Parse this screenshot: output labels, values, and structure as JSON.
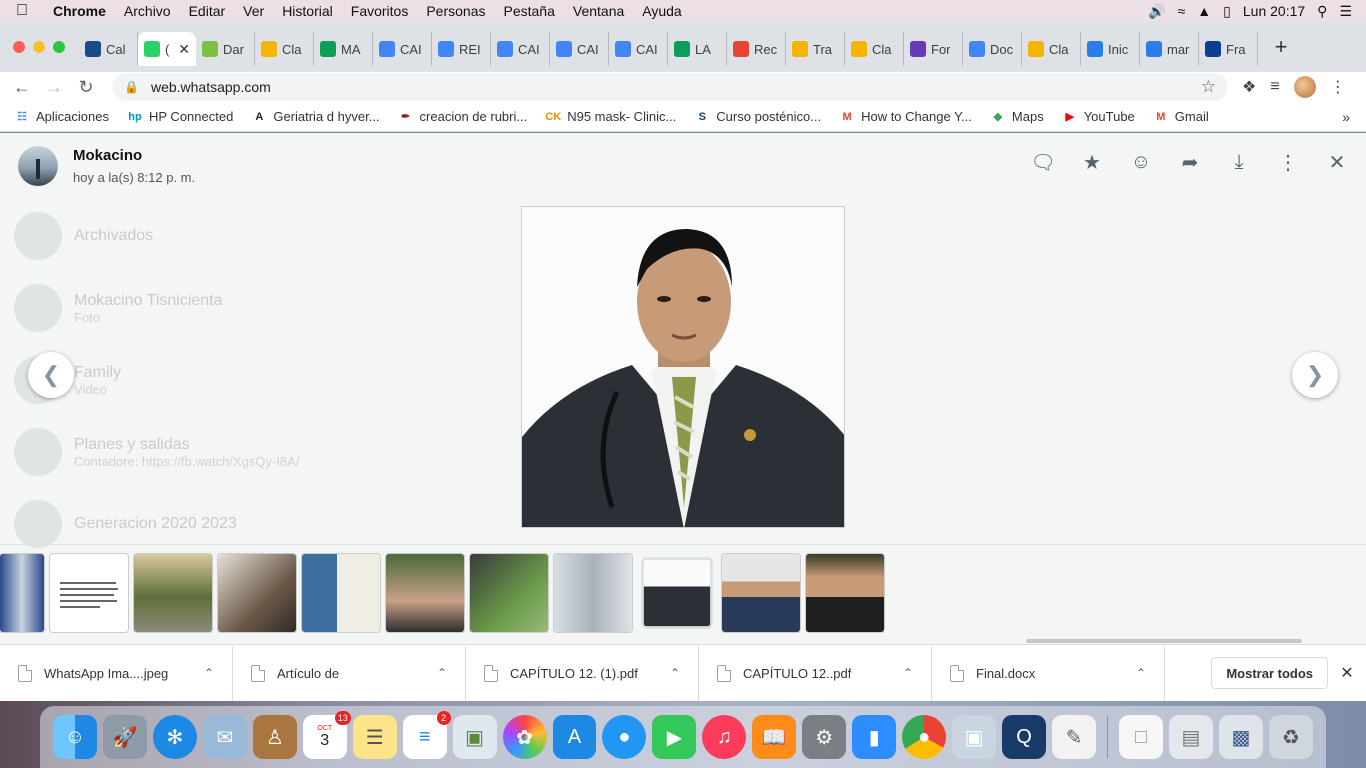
{
  "menubar": {
    "app_name": "Chrome",
    "items": [
      "Archivo",
      "Editar",
      "Ver",
      "Historial",
      "Favoritos",
      "Personas",
      "Pestaña",
      "Ventana",
      "Ayuda"
    ],
    "clock": "Lun 20:17"
  },
  "tabs": [
    {
      "label": "Cal",
      "icon": "cdc-icon",
      "color": "#1a4a8a"
    },
    {
      "label": "(",
      "icon": "whatsapp-icon",
      "color": "#25d366",
      "active": true
    },
    {
      "label": "Dar",
      "icon": "id-icon",
      "color": "#7cc242"
    },
    {
      "label": "Cla",
      "icon": "classroom-icon",
      "color": "#f4b400"
    },
    {
      "label": "MA",
      "icon": "drive-icon",
      "color": "#0f9d58"
    },
    {
      "label": "CAI",
      "icon": "docs-icon",
      "color": "#4285f4"
    },
    {
      "label": "REI",
      "icon": "docs-icon",
      "color": "#4285f4"
    },
    {
      "label": "CAI",
      "icon": "docs-icon",
      "color": "#4285f4"
    },
    {
      "label": "CAI",
      "icon": "docs-icon",
      "color": "#4285f4"
    },
    {
      "label": "CAI",
      "icon": "docs-icon",
      "color": "#4285f4"
    },
    {
      "label": "LA",
      "icon": "sheets-icon",
      "color": "#0f9d58"
    },
    {
      "label": "Rec",
      "icon": "gmail-icon",
      "color": "#ea4335"
    },
    {
      "label": "Tra",
      "icon": "classroom-icon",
      "color": "#f4b400"
    },
    {
      "label": "Cla",
      "icon": "classroom-icon",
      "color": "#f4b400"
    },
    {
      "label": "For",
      "icon": "forms-icon",
      "color": "#673ab7"
    },
    {
      "label": "Doc",
      "icon": "docs-icon",
      "color": "#4285f4"
    },
    {
      "label": "Cla",
      "icon": "classroom-icon",
      "color": "#f4b400"
    },
    {
      "label": "Inic",
      "icon": "c-icon",
      "color": "#2b7de9"
    },
    {
      "label": "mar",
      "icon": "c-icon",
      "color": "#2b7de9"
    },
    {
      "label": "Fra",
      "icon": "book-icon",
      "color": "#0b3d91"
    }
  ],
  "toolbar": {
    "url": "web.whatsapp.com"
  },
  "bookmarks": [
    {
      "label": "Aplicaciones",
      "icon": "apps-grid-icon",
      "color": "#4285f4"
    },
    {
      "label": "HP Connected",
      "icon": "hp-icon",
      "color": "#0096d6"
    },
    {
      "label": "Geriatria d hyver...",
      "icon": "a-icon",
      "color": "#222222"
    },
    {
      "label": "creacion de rubri...",
      "icon": "rubric-icon",
      "color": "#8b1a1a"
    },
    {
      "label": "N95 mask- Clinic...",
      "icon": "ck-icon",
      "color": "#f08c00"
    },
    {
      "label": "Curso posténico...",
      "icon": "s-icon",
      "color": "#1a3d6b"
    },
    {
      "label": "How to Change Y...",
      "icon": "gmail-icon",
      "color": "#ea4335"
    },
    {
      "label": "Maps",
      "icon": "maps-icon",
      "color": "#34a853"
    },
    {
      "label": "YouTube",
      "icon": "youtube-icon",
      "color": "#ff0000"
    },
    {
      "label": "Gmail",
      "icon": "gmail-icon",
      "color": "#ea4335"
    }
  ],
  "viewer": {
    "contact_name": "Mokacino",
    "timestamp": "hoy a la(s) 8:12 p. m.",
    "background_chats": [
      {
        "title": "Archivados",
        "sub": ""
      },
      {
        "title": "Mokacino Tisnicienta",
        "sub": "Foto"
      },
      {
        "title": "Family",
        "sub": "Video"
      },
      {
        "title": "Planes y salidas",
        "sub": "Contadore: https://fb.watch/XgsQy-I8A/"
      },
      {
        "title": "Generacion 2020 2023",
        "sub": ""
      }
    ]
  },
  "downloads": [
    {
      "name": "WhatsApp Ima....jpeg"
    },
    {
      "name": "Artículo de"
    },
    {
      "name": "CAPÍTULO 12. (1).pdf"
    },
    {
      "name": "CAPÍTULO 12..pdf"
    },
    {
      "name": "Final.docx"
    }
  ],
  "downloads_show_all": "Mostrar todos",
  "dock": {
    "calendar_month": "OCT",
    "calendar_day": "3",
    "calendar_badge": "13",
    "reminders_badge": "2"
  }
}
